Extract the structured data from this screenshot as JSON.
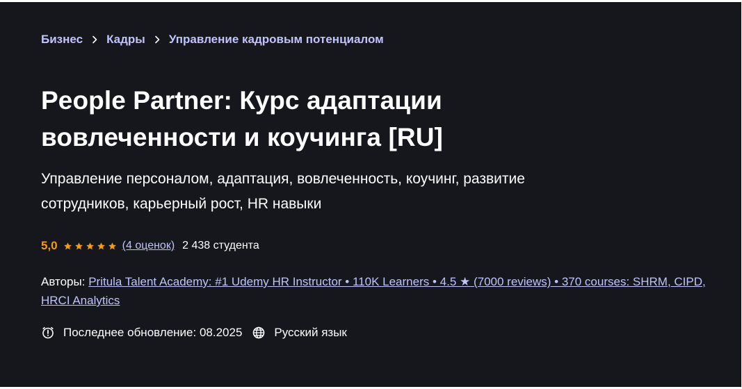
{
  "breadcrumb": {
    "items": [
      {
        "label": "Бизнес"
      },
      {
        "label": "Кадры"
      },
      {
        "label": "Управление кадровым потенциалом"
      }
    ],
    "separator_icon": "chevron-right-icon"
  },
  "course": {
    "title_line1": "People Partner: Курс адаптации",
    "title_line2": "вовлеченности и коучинга [RU]",
    "subtitle_line1": "Управление персоналом, адаптация, вовлеченность, коучинг, развитие",
    "subtitle_line2": "сотрудников, карьерный рост, HR навыки"
  },
  "rating": {
    "score": "5,0",
    "stars": 5,
    "star_color": "#f69c08",
    "count_link": "(4 оценок)",
    "students": "2 438 студента"
  },
  "authors": {
    "label": "Авторы:",
    "link": "Pritula Talent Academy: #1 Udemy HR Instructor • 110K Learners • 4.5 ★ (7000 reviews) • 370 courses: SHRM, CIPD, HRCI Analytics"
  },
  "meta": {
    "update_icon": "alert-clock-icon",
    "last_update": "Последнее обновление: 08.2025",
    "language_icon": "globe-icon",
    "language": "Русский язык"
  },
  "colors": {
    "background": "#16161d",
    "link": "#c0c4fc",
    "rating": "#f69c08",
    "text": "#ffffff"
  }
}
